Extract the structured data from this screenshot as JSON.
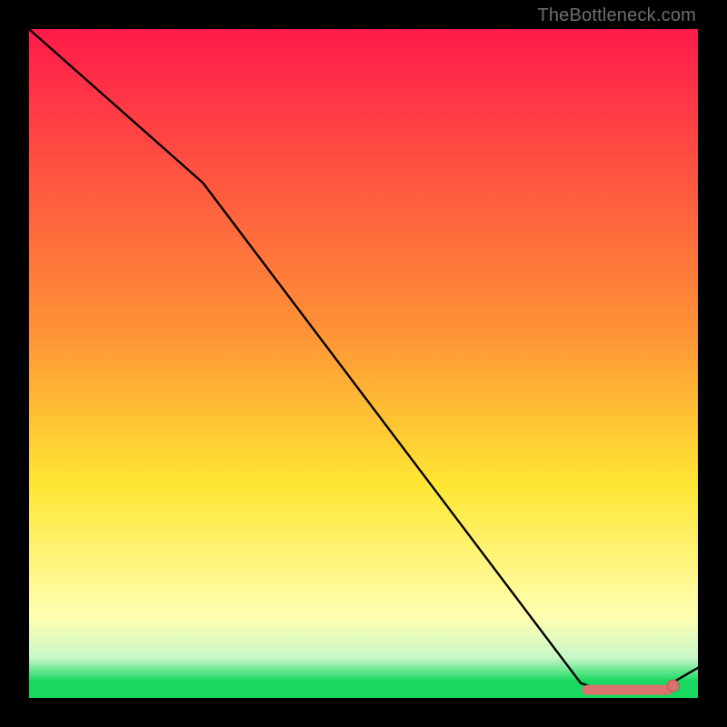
{
  "watermark": "TheBottleneck.com",
  "colors": {
    "top": "#ff1a4b",
    "mid_orange": "#ff9236",
    "mid_yellow": "#ffe633",
    "pale_yellow": "#ffffb3",
    "green_light": "#8eef8e",
    "green": "#18d860",
    "curve": "#000000",
    "marker_fill": "#d9726d",
    "marker_stroke": "#cf544e",
    "frame": "#000000",
    "wm": "#6e6e6e"
  },
  "chart_data": {
    "type": "line",
    "title": "",
    "xlabel": "",
    "ylabel": "",
    "xlim": [
      0,
      100
    ],
    "ylim": [
      0,
      100
    ],
    "series": [
      {
        "name": "curve",
        "x": [
          0,
          26,
          82.5,
          86,
          94,
          100
        ],
        "y": [
          100,
          77,
          2.2,
          1.0,
          1.0,
          4.5
        ]
      }
    ],
    "markers": {
      "thick_segment": {
        "x": [
          83.5,
          95.5
        ],
        "y": [
          1.2,
          1.2
        ]
      },
      "point": {
        "x": 96.3,
        "y": 1.8
      }
    },
    "gradient_stops": [
      {
        "offset": 0.0,
        "color": "#ff1a4b"
      },
      {
        "offset": 0.45,
        "color": "#ff9236"
      },
      {
        "offset": 0.68,
        "color": "#ffe633"
      },
      {
        "offset": 0.88,
        "color": "#ffffb3"
      },
      {
        "offset": 0.94,
        "color": "#c9f7c9"
      },
      {
        "offset": 0.975,
        "color": "#18d860"
      },
      {
        "offset": 1.0,
        "color": "#18d860"
      }
    ]
  }
}
